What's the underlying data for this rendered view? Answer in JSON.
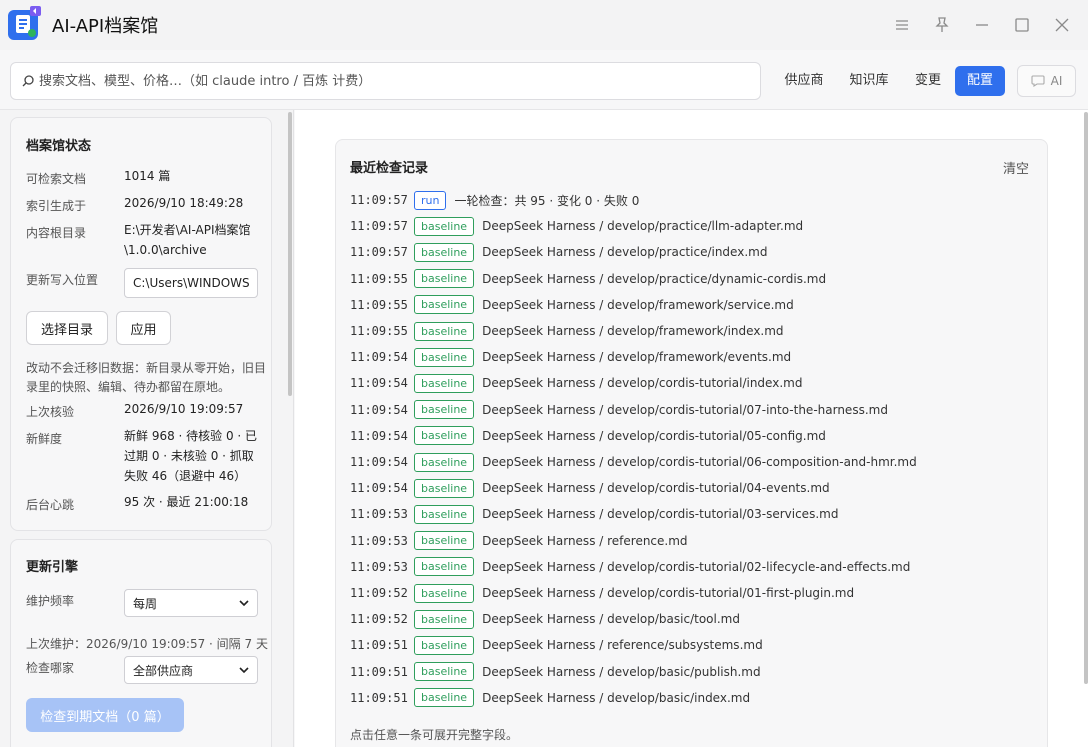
{
  "app": {
    "title": "AI-API档案馆"
  },
  "search": {
    "placeholder": "搜索文档、模型、价格…（如 claude intro / 百炼 计费）"
  },
  "nav": {
    "providers": "供应商",
    "knowledge": "知识库",
    "changes": "变更",
    "config": "配置",
    "ai": "AI"
  },
  "status": {
    "title": "档案馆状态",
    "docs_label": "可检索文档",
    "docs_value": "1014 篇",
    "index_label": "索引生成于",
    "index_value": "2026/9/10 18:49:28",
    "root_label": "内容根目录",
    "root_value": "E:\\开发者\\AI-API档案馆\\1.0.0\\archive",
    "write_label": "更新写入位置",
    "write_value": "C:\\Users\\WINDOWS\\AppData",
    "choose_btn": "选择目录",
    "apply_btn": "应用",
    "note": "改动不会迁移旧数据：新目录从零开始，旧目录里的快照、编辑、待办都留在原地。",
    "lastcheck_label": "上次核验",
    "lastcheck_value": "2026/9/10 19:09:57",
    "fresh_label": "新鲜度",
    "fresh_value": "新鲜 968 · 待核验 0 · 已过期 0 · 未核验 0 · 抓取失败 46（退避中 46）",
    "heartbeat_label": "后台心跳",
    "heartbeat_value": "95 次 · 最近 21:00:18"
  },
  "engine": {
    "title": "更新引擎",
    "freq_label": "维护频率",
    "freq_value": "每周",
    "last_maint": "上次维护：2026/9/10 19:09:57 · 间隔 7 天",
    "which_label": "检查哪家",
    "which_value": "全部供应商",
    "check_btn": "检查到期文档（0 篇）"
  },
  "log": {
    "title": "最近检查记录",
    "clear": "清空",
    "footnote": "点击任意一条可展开完整字段。",
    "rows": [
      {
        "time": "11:09:57",
        "tag": "run",
        "text": "一轮检查：共 95 · 变化 0 · 失败 0"
      },
      {
        "time": "11:09:57",
        "tag": "baseline",
        "text": "DeepSeek Harness / develop/practice/llm-adapter.md"
      },
      {
        "time": "11:09:57",
        "tag": "baseline",
        "text": "DeepSeek Harness / develop/practice/index.md"
      },
      {
        "time": "11:09:55",
        "tag": "baseline",
        "text": "DeepSeek Harness / develop/practice/dynamic-cordis.md"
      },
      {
        "time": "11:09:55",
        "tag": "baseline",
        "text": "DeepSeek Harness / develop/framework/service.md"
      },
      {
        "time": "11:09:55",
        "tag": "baseline",
        "text": "DeepSeek Harness / develop/framework/index.md"
      },
      {
        "time": "11:09:54",
        "tag": "baseline",
        "text": "DeepSeek Harness / develop/framework/events.md"
      },
      {
        "time": "11:09:54",
        "tag": "baseline",
        "text": "DeepSeek Harness / develop/cordis-tutorial/index.md"
      },
      {
        "time": "11:09:54",
        "tag": "baseline",
        "text": "DeepSeek Harness / develop/cordis-tutorial/07-into-the-harness.md"
      },
      {
        "time": "11:09:54",
        "tag": "baseline",
        "text": "DeepSeek Harness / develop/cordis-tutorial/05-config.md"
      },
      {
        "time": "11:09:54",
        "tag": "baseline",
        "text": "DeepSeek Harness / develop/cordis-tutorial/06-composition-and-hmr.md"
      },
      {
        "time": "11:09:54",
        "tag": "baseline",
        "text": "DeepSeek Harness / develop/cordis-tutorial/04-events.md"
      },
      {
        "time": "11:09:53",
        "tag": "baseline",
        "text": "DeepSeek Harness / develop/cordis-tutorial/03-services.md"
      },
      {
        "time": "11:09:53",
        "tag": "baseline",
        "text": "DeepSeek Harness / reference.md"
      },
      {
        "time": "11:09:53",
        "tag": "baseline",
        "text": "DeepSeek Harness / develop/cordis-tutorial/02-lifecycle-and-effects.md"
      },
      {
        "time": "11:09:52",
        "tag": "baseline",
        "text": "DeepSeek Harness / develop/cordis-tutorial/01-first-plugin.md"
      },
      {
        "time": "11:09:52",
        "tag": "baseline",
        "text": "DeepSeek Harness / develop/basic/tool.md"
      },
      {
        "time": "11:09:51",
        "tag": "baseline",
        "text": "DeepSeek Harness / reference/subsystems.md"
      },
      {
        "time": "11:09:51",
        "tag": "baseline",
        "text": "DeepSeek Harness / develop/basic/publish.md"
      },
      {
        "time": "11:09:51",
        "tag": "baseline",
        "text": "DeepSeek Harness / develop/basic/index.md"
      }
    ]
  }
}
